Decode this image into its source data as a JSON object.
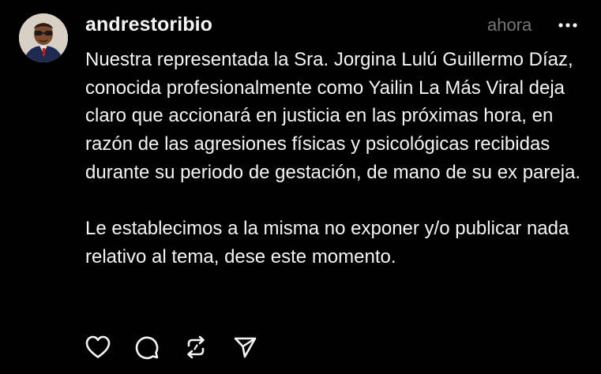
{
  "post": {
    "username": "andrestoribio",
    "timestamp": "ahora",
    "paragraphs": [
      "Nuestra representada la Sra. Jorgina Lulú Guillermo Díaz, conocida profesionalmente como Yailin La Más Viral deja claro que accionará en justicia en las próximas hora, en razón de las agresiones físicas y psicológicas recibidas durante su periodo de gestación, de mano de su ex pareja.",
      "Le establecimos a la misma no exponer y/o publicar nada relativo al tema, dese este momento."
    ]
  },
  "icons": {
    "more": "more-horizontal-icon",
    "like": "heart-icon",
    "reply": "comment-icon",
    "repost": "repost-icon",
    "share": "send-icon"
  },
  "colors": {
    "background": "#000000",
    "text": "#f3f5f7",
    "muted": "#777777"
  }
}
